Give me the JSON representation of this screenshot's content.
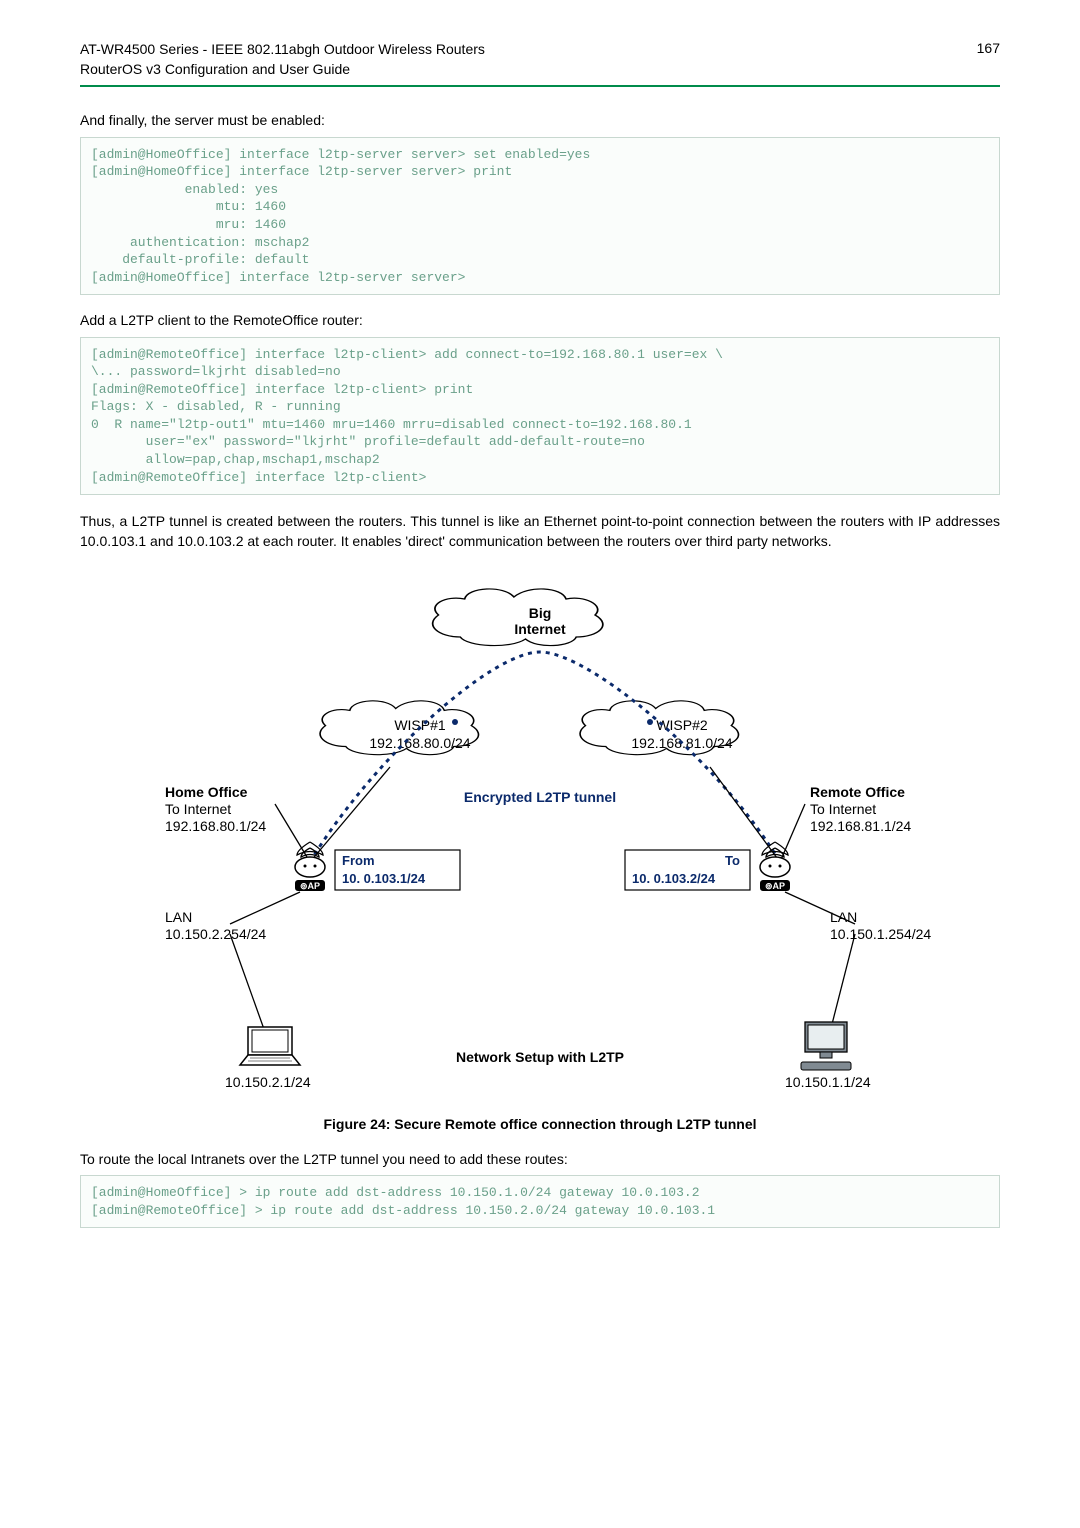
{
  "header": {
    "title_line1": "AT-WR4500 Series - IEEE 802.11abgh Outdoor Wireless Routers",
    "title_line2": "RouterOS v3 Configuration and User Guide",
    "page_number": "167"
  },
  "sections": {
    "server_enable_intro": "And finally, the server must be enabled:",
    "code1": "[admin@HomeOffice] interface l2tp-server server> set enabled=yes\n[admin@HomeOffice] interface l2tp-server server> print\n            enabled: yes\n                mtu: 1460\n                mru: 1460\n     authentication: mschap2\n    default-profile: default\n[admin@HomeOffice] interface l2tp-server server>",
    "add_client_intro": "Add a L2TP client to the RemoteOffice router:",
    "code2": "[admin@RemoteOffice] interface l2tp-client> add connect-to=192.168.80.1 user=ex \\\n\\... password=lkjrht disabled=no\n[admin@RemoteOffice] interface l2tp-client> print\nFlags: X - disabled, R - running\n0  R name=\"l2tp-out1\" mtu=1460 mru=1460 mrru=disabled connect-to=192.168.80.1\n       user=\"ex\" password=\"lkjrht\" profile=default add-default-route=no\n       allow=pap,chap,mschap1,mschap2\n[admin@RemoteOffice] interface l2tp-client>",
    "tunnel_para": "Thus, a L2TP tunnel is created between the routers. This tunnel is like an Ethernet point-to-point connection between the routers with IP addresses 10.0.103.1 and 10.0.103.2 at each router. It enables 'direct' communication between the routers over third party networks.",
    "route_intro": "To route the local Intranets over the L2TP tunnel you need to add these routes:",
    "code3": "[admin@HomeOffice] > ip route add dst-address 10.150.1.0/24 gateway 10.0.103.2\n[admin@RemoteOffice] > ip route add dst-address 10.150.2.0/24 gateway 10.0.103.1"
  },
  "figure": {
    "caption": "Figure 24: Secure Remote office connection through L2TP tunnel",
    "big_internet": "Big\nInternet",
    "wisp1": "WISP#1",
    "wisp1_ip": "192.168.80.0/24",
    "wisp2": "WISP#2",
    "wisp2_ip": "192.168.81.0/24",
    "encrypted": "Encrypted L2TP tunnel",
    "home_office": "Home Office",
    "home_to": "To Internet",
    "home_ip": "192.168.80.1/24",
    "remote_office": "Remote Office",
    "remote_to": "To Internet",
    "remote_ip": "192.168.81.1/24",
    "from": "From",
    "from_ip": "10. 0.103.1/24",
    "to": "To",
    "to_ip": "10. 0.103.2/24",
    "lan_left": "LAN",
    "lan_left_ip": "10.150.2.254/24",
    "lan_right": "LAN",
    "lan_right_ip": "10.150.1.254/24",
    "laptop_ip": "10.150.2.1/24",
    "pc_ip": "10.150.1.1/24",
    "net_setup": "Network Setup with L2TP"
  }
}
